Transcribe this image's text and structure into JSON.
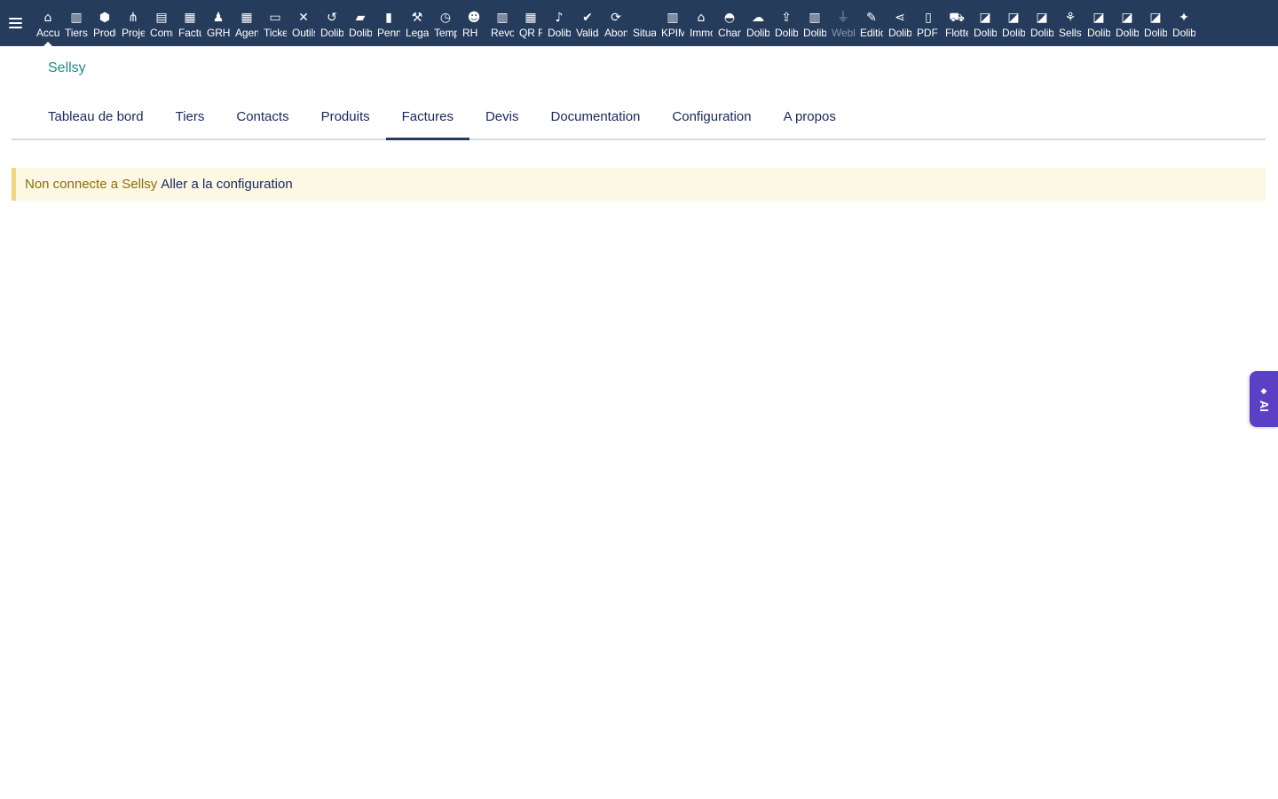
{
  "topbar": {
    "menu_icon": "hamburger-icon",
    "modules": [
      {
        "label": "Accueil",
        "icon": "⌂",
        "name": "home"
      },
      {
        "label": "Tiers",
        "icon": "▥",
        "name": "building"
      },
      {
        "label": "Produits",
        "icon": "⬢",
        "name": "cube"
      },
      {
        "label": "Projets",
        "icon": "⋔",
        "name": "project"
      },
      {
        "label": "Commercial",
        "icon": "▤",
        "name": "briefcase"
      },
      {
        "label": "Facturation",
        "icon": "▦",
        "name": "invoice"
      },
      {
        "label": "GRH",
        "icon": "♟",
        "name": "users"
      },
      {
        "label": "Agenda",
        "icon": "▦",
        "name": "calendar"
      },
      {
        "label": "Tickets",
        "icon": "▭",
        "name": "ticket"
      },
      {
        "label": "Outils",
        "icon": "✕",
        "name": "tools"
      },
      {
        "label": "Dolibarr",
        "icon": "↺",
        "name": "undo"
      },
      {
        "label": "Dolibarr",
        "icon": "▰",
        "name": "toolbox"
      },
      {
        "label": "Penny",
        "icon": "▮",
        "name": "note"
      },
      {
        "label": "Legal",
        "icon": "⚒",
        "name": "gavel"
      },
      {
        "label": "Temps",
        "icon": "◷",
        "name": "clock"
      },
      {
        "label": "RH",
        "icon": "☻",
        "name": "people"
      },
      {
        "label": "Revolut",
        "icon": "▥",
        "name": "bank"
      },
      {
        "label": "QR Facture",
        "icon": "▦",
        "name": "qrcode"
      },
      {
        "label": "Dolibarr",
        "icon": "♪",
        "name": "bell"
      },
      {
        "label": "Validation",
        "icon": "✔",
        "name": "check-double"
      },
      {
        "label": "Abonnements",
        "icon": "⟳",
        "name": "sync"
      },
      {
        "label": "Situation",
        "icon": "",
        "name": "blank"
      },
      {
        "label": "KPIManager",
        "icon": "▥",
        "name": "chart-bar"
      },
      {
        "label": "Immobilier",
        "icon": "⌂",
        "name": "house"
      },
      {
        "label": "Chantier",
        "icon": "◓",
        "name": "helmet"
      },
      {
        "label": "Dolibarr",
        "icon": "☁",
        "name": "cloud"
      },
      {
        "label": "Dolibarr",
        "icon": "⇪",
        "name": "upload"
      },
      {
        "label": "Dolibarr",
        "icon": "▥",
        "name": "building-2"
      },
      {
        "label": "Webhook",
        "icon": "⏚",
        "name": "plug"
      },
      {
        "label": "Edition",
        "icon": "✎",
        "name": "edit"
      },
      {
        "label": "Dolibarr",
        "icon": "⋖",
        "name": "share"
      },
      {
        "label": "PDF",
        "icon": "▯",
        "name": "pdf"
      },
      {
        "label": "Flotte",
        "icon": "⛟",
        "name": "car"
      },
      {
        "label": "Dolibarr",
        "icon": "◪",
        "name": "sticky-note"
      },
      {
        "label": "Dolibarr",
        "icon": "◪",
        "name": "sticky-note-2"
      },
      {
        "label": "Dolibarr",
        "icon": "◪",
        "name": "sticky-note-3"
      },
      {
        "label": "Sellsy",
        "icon": "⚘",
        "name": "handshake"
      },
      {
        "label": "Dolibarr",
        "icon": "◪",
        "name": "sticky-note-4"
      },
      {
        "label": "Dolibarr",
        "icon": "◪",
        "name": "sticky-note-5"
      },
      {
        "label": "Dolibarr",
        "icon": "◪",
        "name": "sticky-note-6"
      },
      {
        "label": "Dolibarr",
        "icon": "✦",
        "name": "magic"
      }
    ]
  },
  "page": {
    "title": "Sellsy"
  },
  "tabs": [
    {
      "label": "Tableau de bord",
      "active": false
    },
    {
      "label": "Tiers",
      "active": false
    },
    {
      "label": "Contacts",
      "active": false
    },
    {
      "label": "Produits",
      "active": false
    },
    {
      "label": "Factures",
      "active": true
    },
    {
      "label": "Devis",
      "active": false
    },
    {
      "label": "Documentation",
      "active": false
    },
    {
      "label": "Configuration",
      "active": false
    },
    {
      "label": "A propos",
      "active": false
    }
  ],
  "banner": {
    "message": "Non connecte a Sellsy",
    "link": "Aller a la configuration"
  },
  "ai_tab": {
    "label": "AI",
    "icon": "◆"
  },
  "colors": {
    "topbar_bg": "#263c5c",
    "title": "#1f8a87",
    "tab_text": "#1c2a61",
    "banner_bg": "#fcf8e3",
    "banner_text": "#8a6d0b",
    "ai_tab_bg": "#5b3fc4"
  }
}
